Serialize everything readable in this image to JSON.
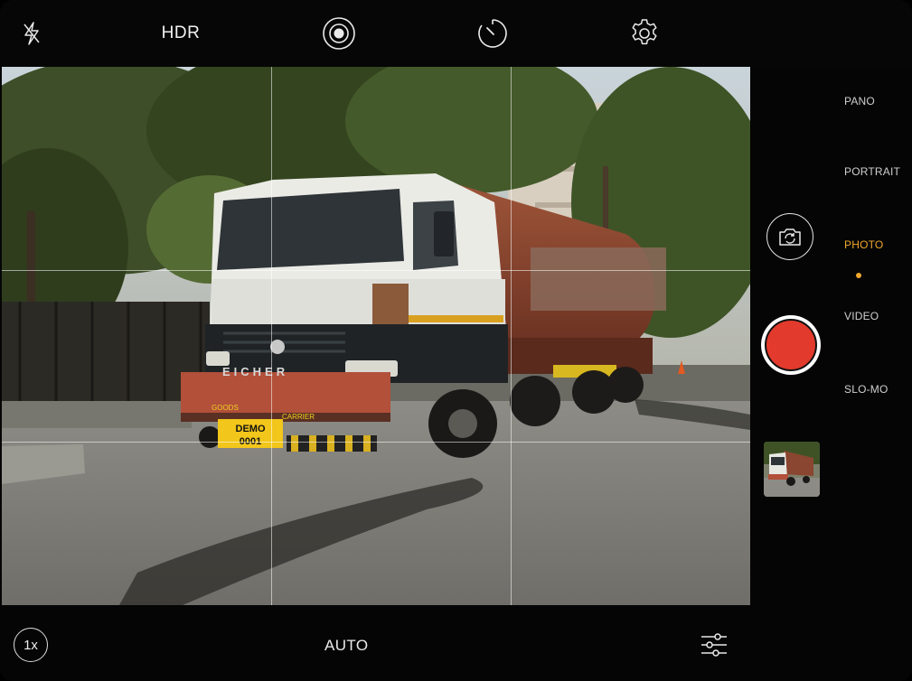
{
  "top_bar": {
    "flash_icon": "flash-off-icon",
    "hdr_label": "HDR",
    "live_icon": "live-photo-icon",
    "timer_icon": "timer-icon",
    "settings_icon": "gear-icon"
  },
  "viewfinder": {
    "plate_line1": "DEMO",
    "plate_line2": "0001",
    "truck_brand": "EICHER",
    "bumper_left": "GOODS",
    "bumper_right": "CARRIER"
  },
  "modes": {
    "items": [
      {
        "label": "PANO",
        "active": false
      },
      {
        "label": "PORTRAIT",
        "active": false
      },
      {
        "label": "PHOTO",
        "active": true
      },
      {
        "label": "VIDEO",
        "active": false
      },
      {
        "label": "SLO-MO",
        "active": false
      }
    ],
    "accent_color": "#f0a72b"
  },
  "controls": {
    "flip_icon": "switch-camera-icon",
    "shutter_color": "#e23a2c",
    "thumbnail_icon": "gallery-thumbnail"
  },
  "bottom_bar": {
    "zoom_label": "1x",
    "exposure_label": "AUTO",
    "adjust_icon": "sliders-icon"
  }
}
